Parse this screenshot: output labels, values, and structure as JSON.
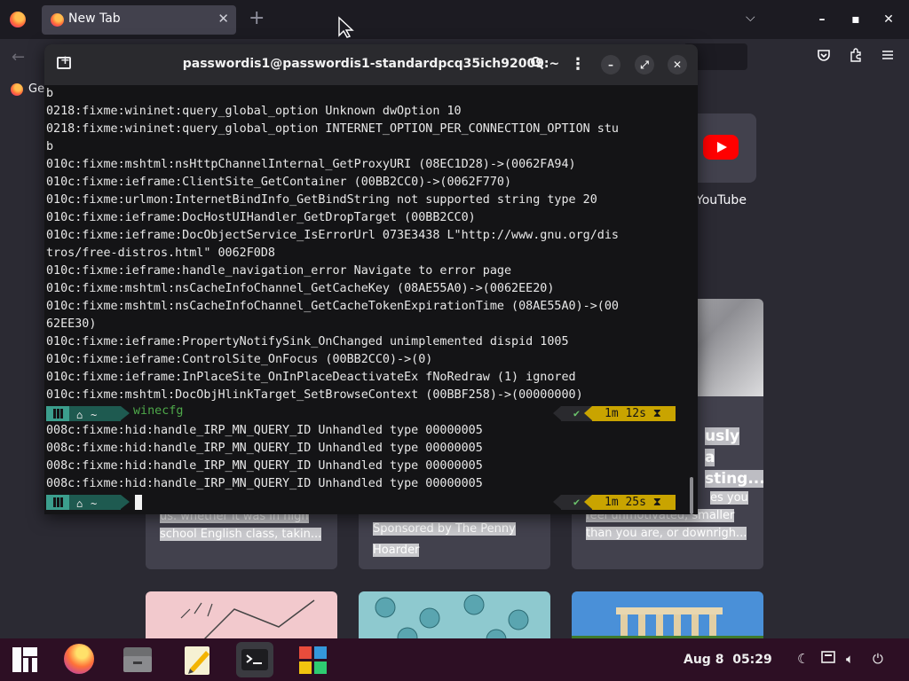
{
  "browser": {
    "tab_title": "New Tab",
    "tab_close": "✕",
    "new_tab": "+",
    "tab_list": "⌵",
    "bookmark_label": "Ge",
    "shortcut_label": "YouTube"
  },
  "cards": {
    "card1_lines": [
      "us. whether it was in high",
      "school English class, takin..."
    ],
    "card2_lines": [
      "Sponsored by The Penny",
      "Hoarder"
    ],
    "card3_title_lines": [
      "usly",
      "a",
      "sting..."
    ],
    "card3_lines": [
      "es you",
      "feel unmotivated, smaller",
      "than you are, or downrigh..."
    ]
  },
  "terminal": {
    "title": "passwordis1@passwordis1-standardpcq35ich92009:~",
    "lines_before": [
      "b",
      "0218:fixme:wininet:query_global_option Unknown dwOption 10",
      "0218:fixme:wininet:query_global_option INTERNET_OPTION_PER_CONNECTION_OPTION stu",
      "b",
      "010c:fixme:mshtml:nsHttpChannelInternal_GetProxyURI (08EC1D28)->(0062FA94)",
      "010c:fixme:ieframe:ClientSite_GetContainer (00BB2CC0)->(0062F770)",
      "010c:fixme:urlmon:InternetBindInfo_GetBindString not supported string type 20",
      "010c:fixme:ieframe:DocHostUIHandler_GetDropTarget (00BB2CC0)",
      "010c:fixme:ieframe:DocObjectService_IsErrorUrl 073E3438 L\"http://www.gnu.org/dis",
      "tros/free-distros.html\" 0062F0D8",
      "010c:fixme:ieframe:handle_navigation_error Navigate to error page",
      "010c:fixme:mshtml:nsCacheInfoChannel_GetCacheKey (08AE55A0)->(0062EE20)",
      "010c:fixme:mshtml:nsCacheInfoChannel_GetCacheTokenExpirationTime (08AE55A0)->(00",
      "62EE30)",
      "010c:fixme:ieframe:PropertyNotifySink_OnChanged unimplemented dispid 1005",
      "010c:fixme:ieframe:ControlSite_OnFocus (00BB2CC0)->(0)",
      "010c:fixme:ieframe:InPlaceSite_OnInPlaceDeactivateEx fNoRedraw (1) ignored",
      "010c:fixme:mshtml:DocObjHlinkTarget_SetBrowseContext (00BBF258)->(00000000)"
    ],
    "prompt1": {
      "home": "~",
      "command": "winecfg",
      "check": "✔",
      "duration": "1m 12s",
      "hourglass": "⧗"
    },
    "lines_after": [
      "008c:fixme:hid:handle_IRP_MN_QUERY_ID Unhandled type 00000005",
      "008c:fixme:hid:handle_IRP_MN_QUERY_ID Unhandled type 00000005",
      "008c:fixme:hid:handle_IRP_MN_QUERY_ID Unhandled type 00000005",
      "008c:fixme:hid:handle_IRP_MN_QUERY_ID Unhandled type 00000005"
    ],
    "prompt2": {
      "home": "~",
      "check": "✔",
      "duration": "1m 25s",
      "hourglass": "⧗"
    }
  },
  "taskbar": {
    "date": "Aug 8",
    "time": "05:29"
  },
  "colors": {
    "terminal_bg": "#141416",
    "prompt_teal": "#3b9e8d",
    "duration_yellow": "#c9a400",
    "taskbar_bg": "#2d0f24"
  }
}
